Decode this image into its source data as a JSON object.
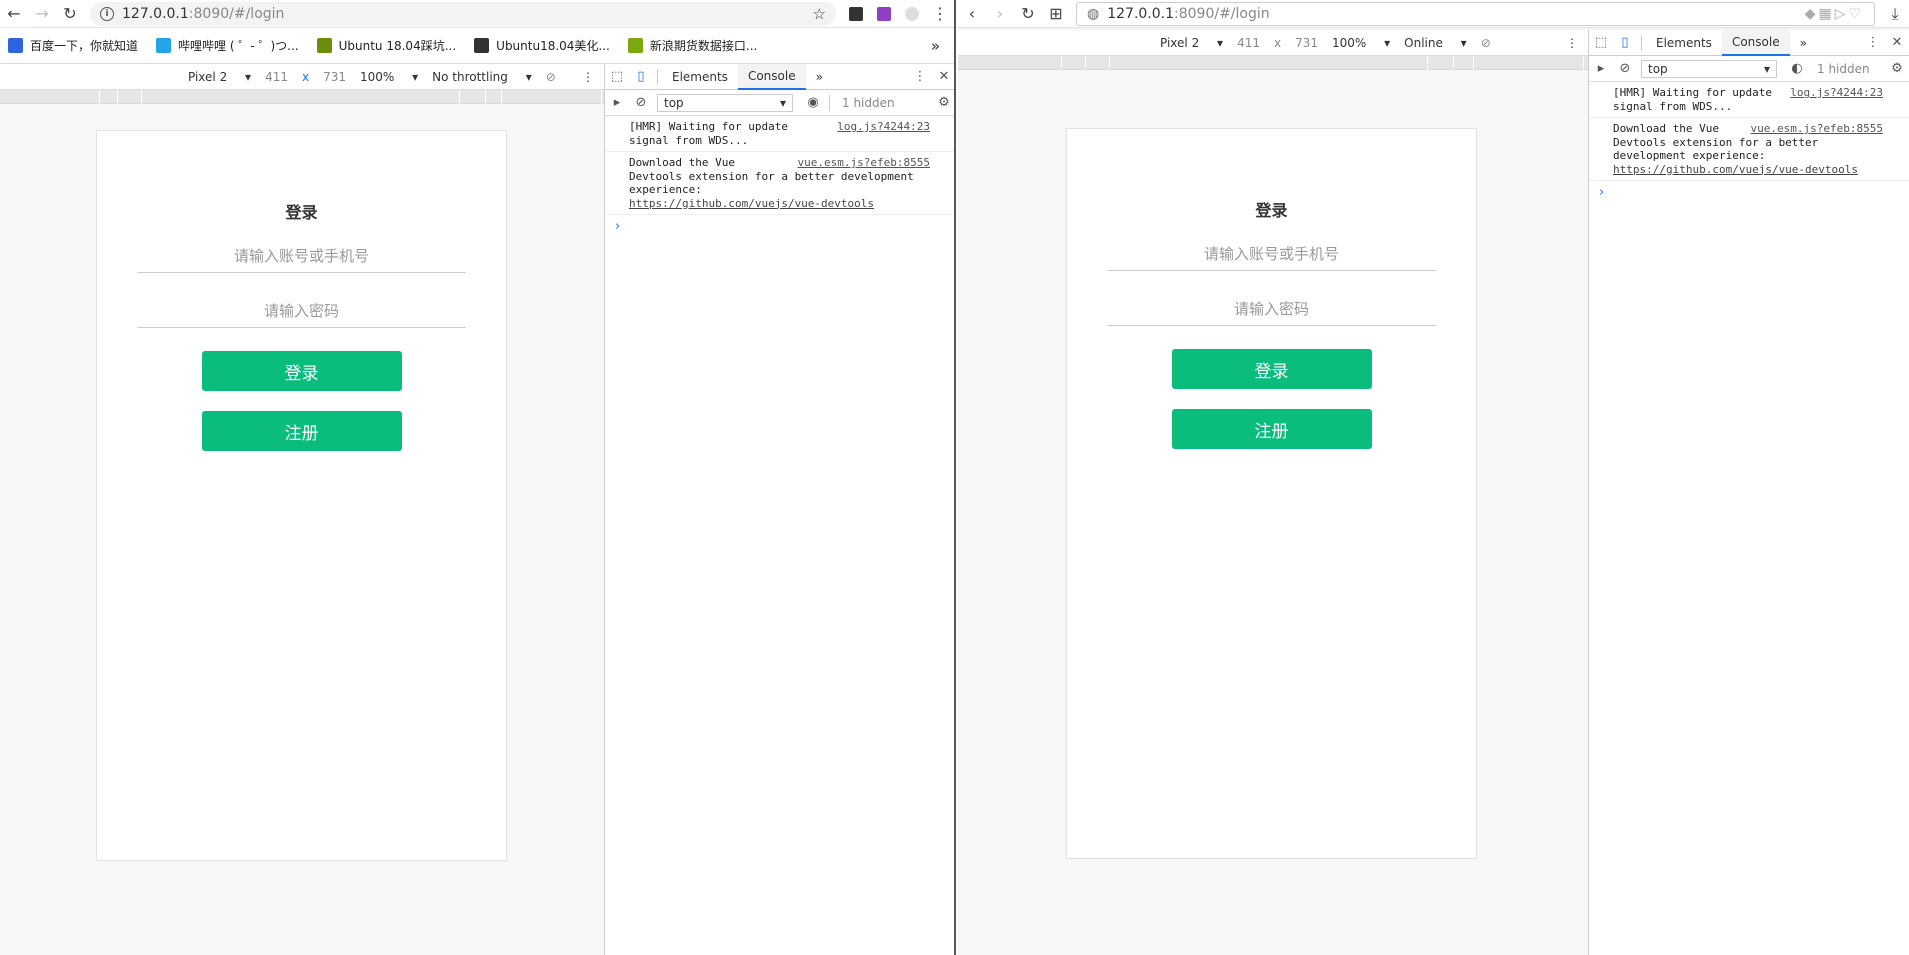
{
  "left_window": {
    "url_host": "127.0.0.1",
    "url_rest": ":8090/#/login",
    "bookmarks": [
      {
        "label": "百度一下，你就知道",
        "color": "#2f63e0",
        "icon": "paw-icon"
      },
      {
        "label": "哔哩哔哩 ( ゜- ゜)つ...",
        "color": "#22a5e8",
        "icon": "tv-icon"
      },
      {
        "label": "Ubuntu 18.04踩坑...",
        "color": "#6b8f0a",
        "icon": "y-icon"
      },
      {
        "label": "Ubuntu18.04美化...",
        "color": "#333333",
        "icon": "ap-icon"
      },
      {
        "label": "新浪期货数据接口...",
        "color": "#7aa80d",
        "icon": "grid-icon"
      }
    ],
    "device": {
      "name": "Pixel 2",
      "width": "411",
      "x": "x",
      "height": "731",
      "zoom": "100%",
      "throttle": "No throttling"
    },
    "login": {
      "title": "登录",
      "account_placeholder": "请输入账号或手机号",
      "password_placeholder": "请输入密码",
      "login_button": "登录",
      "register_button": "注册"
    },
    "devtools": {
      "tab_elements": "Elements",
      "tab_console": "Console",
      "more": "»",
      "context": "top",
      "hidden": "1 hidden"
    }
  },
  "right_window": {
    "url": "127.0.0.1",
    "url_rest": ":8090/#/login",
    "device": {
      "name": "Pixel 2",
      "width": "411",
      "x": "x",
      "height": "731",
      "zoom": "100%",
      "throttle": "Online"
    },
    "login": {
      "title": "登录",
      "account_placeholder": "请输入账号或手机号",
      "password_placeholder": "请输入密码",
      "login_button": "登录",
      "register_button": "注册"
    },
    "devtools": {
      "tab_elements": "Elements",
      "tab_console": "Console",
      "more": "»",
      "context": "top",
      "hidden": "1 hidden"
    }
  },
  "console_messages": [
    {
      "text": "[HMR] Waiting for update\nsignal from WDS...",
      "source": "log.js?4244:23"
    },
    {
      "text": "Download the Vue\nDevtools extension for a better development\nexperience:",
      "source": "vue.esm.js?efeb:8555",
      "link": "https://github.com/vuejs/vue-devtools"
    }
  ],
  "console_messages_right": [
    {
      "text": "[HMR] Waiting for update\nsignal from WDS...",
      "source": "log.js?4244:23"
    },
    {
      "text": "Download the Vue\nDevtools extension for a better\ndevelopment experience:",
      "source": "vue.esm.js?efeb:8555",
      "link": "https://github.com/vuejs/vue-devtools"
    }
  ],
  "prompt_symbol": "›"
}
